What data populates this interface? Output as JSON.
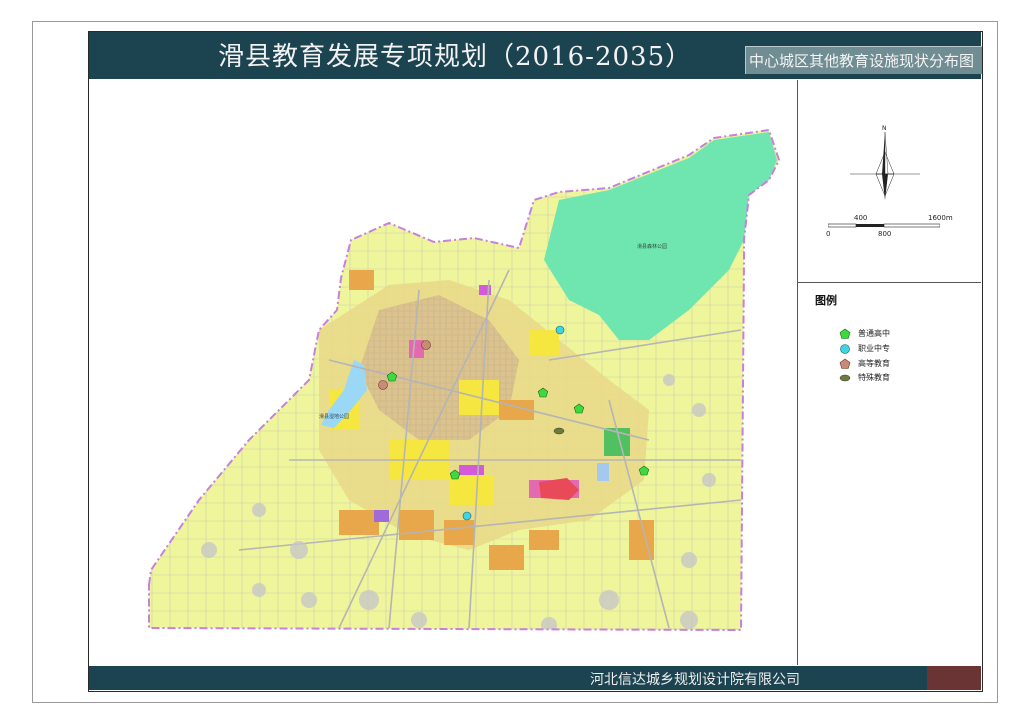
{
  "header": {
    "title": "滑县教育发展专项规划（2016-2035）",
    "subtitle": "中心城区其他教育设施现状分布图"
  },
  "footer": {
    "company": "河北信达城乡规划设计院有限公司"
  },
  "compass": {
    "north_label": "N"
  },
  "scale_bar": {
    "tick_top_1": "400",
    "tick_top_2": "1600m",
    "tick_bottom_0": "0",
    "tick_bottom_1": "800"
  },
  "legend": {
    "title": "图例",
    "items": [
      {
        "label": "普通高中",
        "symbol": "pentagon",
        "color": "#3dd93d"
      },
      {
        "label": "职业中专",
        "symbol": "circle",
        "color": "#3fd6e0"
      },
      {
        "label": "高等教育",
        "symbol": "pentagon-round",
        "color": "#c98a78"
      },
      {
        "label": "特殊教育",
        "symbol": "ellipse",
        "color": "#6e7a3a"
      }
    ]
  },
  "map_labels": {
    "park": "滑县森林公园",
    "wetland": "滑县湿地公园"
  },
  "colors": {
    "header_bg": "#1c4350",
    "land_base": "#eef59a",
    "forest_park": "#6fe6b0",
    "boundary": "#c77fe0"
  }
}
